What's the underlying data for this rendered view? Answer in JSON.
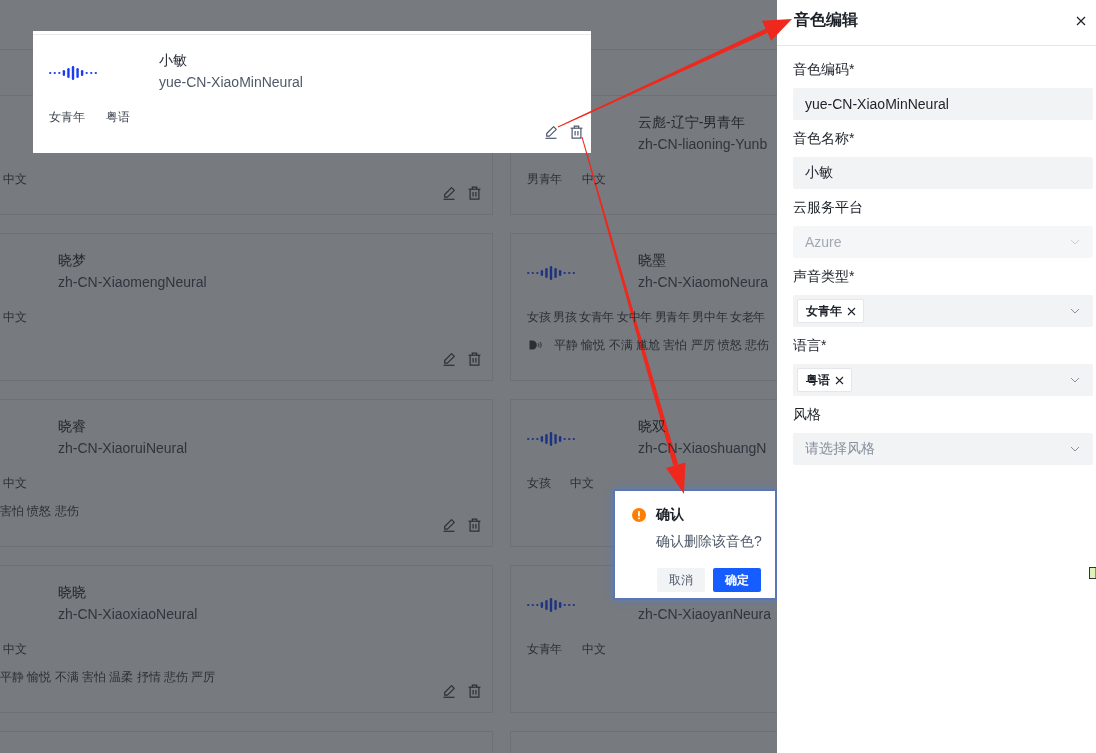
{
  "spotlight_card": {
    "name": "小敏",
    "code": "yue-CN-XiaoMinNeural",
    "voice_type": "女青年",
    "language": "粤语"
  },
  "card_rows": [
    {
      "cards": [
        {
          "language": "中文",
          "waveform": false,
          "actions": true
        },
        {
          "name": "云彪-辽宁-男青年",
          "code": "zh-CN-liaoning-Yunb",
          "voice_type": "男青年",
          "language": "中文",
          "waveform": false,
          "actions": false
        }
      ]
    },
    {
      "cards": [
        {
          "name": "晓梦",
          "code": "zh-CN-XiaomengNeural",
          "language": "中文",
          "waveform": false,
          "actions": true
        },
        {
          "name": "晓墨",
          "code": "zh-CN-XiaomoNeura",
          "voice_type": "女孩 男孩 女青年 女中年 男青年 男中年 女老年",
          "styles": "平静 愉悦 不满 尴尬 害怕 严厉 愤怒 悲伤",
          "waveform": true,
          "actions": false
        }
      ]
    },
    {
      "cards": [
        {
          "name": "晓睿",
          "code": "zh-CN-XiaoruiNeural",
          "language": "中文",
          "styles": "害怕 愤怒 悲伤",
          "waveform": false,
          "actions": true
        },
        {
          "name": "晓双",
          "code": "zh-CN-XiaoshuangN",
          "voice_type": "女孩",
          "language": "中文",
          "waveform": true,
          "actions": false
        }
      ]
    },
    {
      "cards": [
        {
          "name": "晓晓",
          "code": "zh-CN-XiaoxiaoNeural",
          "language": "中文",
          "styles": "平静 愉悦 不满 害怕 温柔 抒情 悲伤 严厉",
          "waveform": false,
          "actions": true
        },
        {
          "code": "zh-CN-XiaoyanNeura",
          "voice_type": "女青年",
          "language": "中文",
          "waveform": true,
          "actions": false
        }
      ]
    },
    {
      "cards": [
        {
          "waveform": false,
          "actions": false
        },
        {
          "waveform": false,
          "actions": false
        }
      ]
    }
  ],
  "popconfirm": {
    "title": "确认",
    "message": "确认删除该音色?",
    "buttons": [
      {
        "label": "取消",
        "kind": "secondary"
      },
      {
        "label": "确定",
        "kind": "primary"
      }
    ]
  },
  "drawer": {
    "title": "音色编辑",
    "fields": [
      {
        "kind": "input",
        "label": "音色编码*",
        "value": "yue-CN-XiaoMinNeural",
        "disabled": false
      },
      {
        "kind": "input",
        "label": "音色名称*",
        "value": "小敏",
        "disabled": false
      },
      {
        "kind": "select",
        "label": "云服务平台",
        "value": "Azure",
        "disabled": true
      },
      {
        "kind": "tags",
        "label": "声音类型*",
        "tags": [
          "女青年"
        ],
        "disabled": false
      },
      {
        "kind": "tags",
        "label": "语言*",
        "tags": [
          "粤语"
        ],
        "disabled": false
      },
      {
        "kind": "select",
        "label": "风格",
        "placeholder": "请选择风格",
        "disabled": false
      }
    ]
  }
}
